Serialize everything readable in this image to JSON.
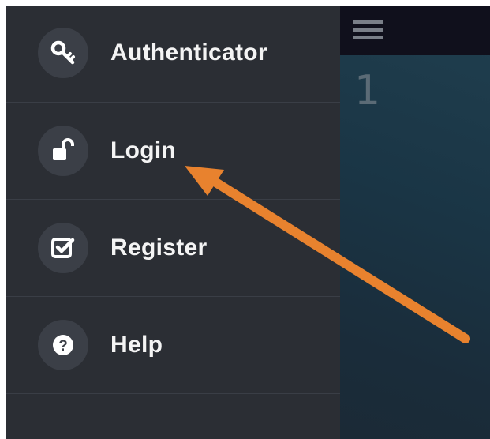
{
  "menu": {
    "items": [
      {
        "label": "Authenticator",
        "icon": "key-icon"
      },
      {
        "label": "Login",
        "icon": "unlock-icon"
      },
      {
        "label": "Register",
        "icon": "checkbox-icon"
      },
      {
        "label": "Help",
        "icon": "help-icon"
      }
    ]
  },
  "content": {
    "step_number": "1"
  },
  "colors": {
    "drawer_bg": "#2b2e34",
    "arrow": "#e8822e",
    "topbar": "#10101c"
  }
}
